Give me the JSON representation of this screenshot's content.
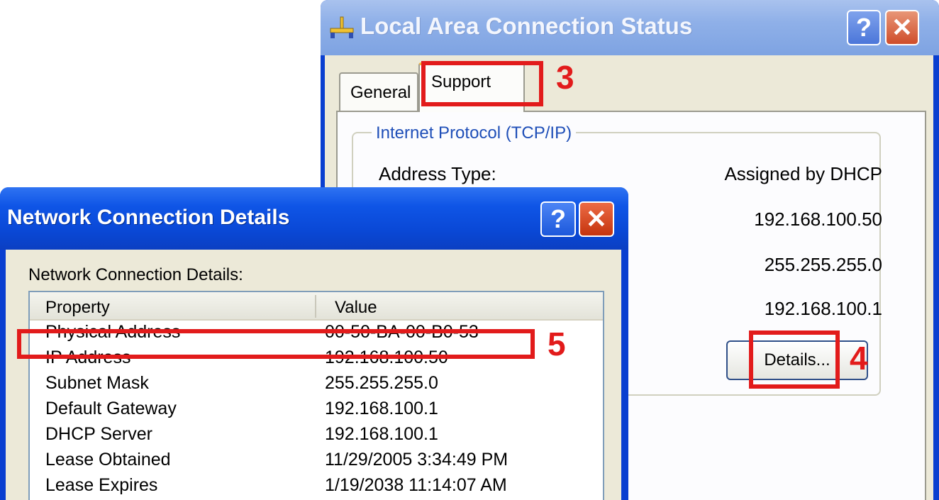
{
  "status_window": {
    "title": "Local Area Connection Status",
    "help_glyph": "?",
    "close_glyph": "✕",
    "tabs": [
      {
        "label": "General"
      },
      {
        "label": "Support"
      }
    ],
    "group_title": "Internet Protocol (TCP/IP)",
    "address_type_label": "Address Type:",
    "address_type_value": "Assigned by DHCP",
    "ip_value": "192.168.100.50",
    "subnet_value": "255.255.255.0",
    "gateway_value": "192.168.100.1",
    "details_button": "Details..."
  },
  "details_window": {
    "title": "Network Connection Details",
    "help_glyph": "?",
    "close_glyph": "✕",
    "section_label": "Network Connection Details:",
    "columns": [
      "Property",
      "Value"
    ],
    "rows": [
      {
        "property": "Physical Address",
        "value": "00-50-BA-00-B0-53"
      },
      {
        "property": "IP Address",
        "value": "192.168.100.50"
      },
      {
        "property": "Subnet Mask",
        "value": "255.255.255.0"
      },
      {
        "property": "Default Gateway",
        "value": "192.168.100.1"
      },
      {
        "property": "DHCP Server",
        "value": "192.168.100.1"
      },
      {
        "property": "Lease Obtained",
        "value": "11/29/2005 3:34:49 PM"
      },
      {
        "property": "Lease Expires",
        "value": "1/19/2038 11:14:07 AM"
      }
    ]
  },
  "annotations": {
    "step3": "3",
    "step4": "4",
    "step5": "5",
    "color": "#e21b1b"
  },
  "colors": {
    "xp_blue": "#0a3fd0",
    "dialog_face": "#ece9d8",
    "tab_highlight": "#f2b33d",
    "group_title": "#1f4fb8"
  }
}
